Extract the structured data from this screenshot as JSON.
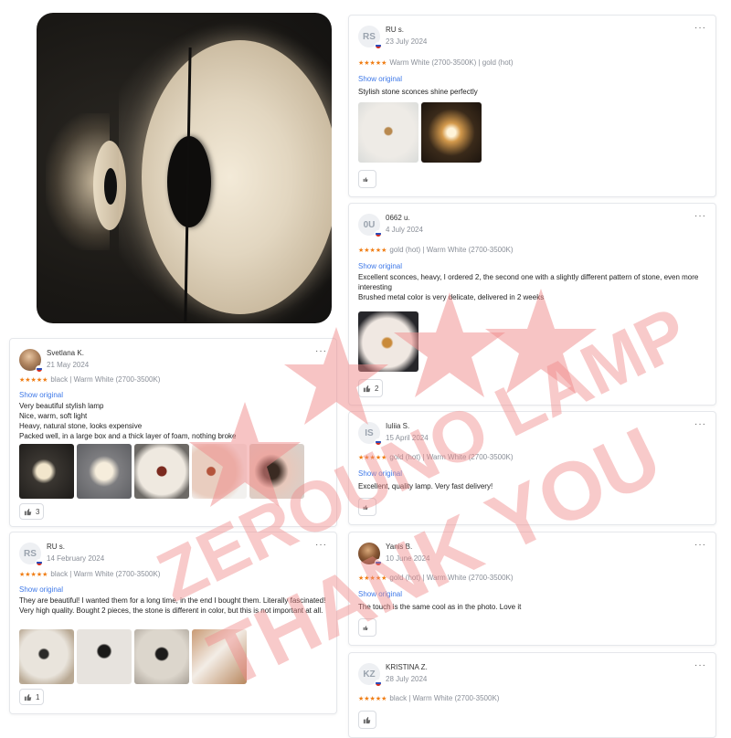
{
  "hero": {
    "alt": "wall sconce photo"
  },
  "reviews_left": [
    {
      "initials": "",
      "avatar_type": "photo",
      "name": "Svetlana K.",
      "date": "21 May 2024",
      "stars": "★★★★★",
      "variant": "black | Warm White (2700-3500K)",
      "show_original": "Show original",
      "lines": [
        "Very beautiful stylish lamp",
        "Nice, warm, soft light",
        "Heavy, natural stone, looks expensive",
        "Packed well, in a large box and a thick layer of foam, nothing broke"
      ],
      "likes": "3",
      "more": "···"
    },
    {
      "initials": "RS",
      "avatar_type": "initials",
      "name": "RU s.",
      "date": "14 February 2024",
      "stars": "★★★★★",
      "variant": "black | Warm White (2700-3500K)",
      "show_original": "Show original",
      "lines": [
        "They are beautiful! I wanted them for a long time, in the end I bought them. Literally fascinated!",
        "Very high quality. Bought 2 pieces, the stone is different in color, but this is not important at all."
      ],
      "likes": "1",
      "more": "···"
    }
  ],
  "reviews_right": [
    {
      "initials": "RS",
      "avatar_type": "initials",
      "name": "RU s.",
      "date": "23 July 2024",
      "stars": "★★★★★",
      "variant": "Warm White (2700-3500K) | gold (hot)",
      "show_original": "Show original",
      "lines": [
        "Stylish stone sconces shine perfectly"
      ],
      "likes": "",
      "more": "···"
    },
    {
      "initials": "0U",
      "avatar_type": "initials",
      "name": "0662 u.",
      "date": "4 July 2024",
      "stars": "★★★★★",
      "variant": "gold (hot) | Warm White (2700-3500K)",
      "show_original": "Show original",
      "lines": [
        "Excellent sconces, heavy, I ordered 2, the second one with a slightly different pattern of stone, even more interesting",
        "Brushed metal color is very delicate, delivered in 2 weeks"
      ],
      "likes": "2",
      "more": "···"
    },
    {
      "initials": "IS",
      "avatar_type": "initials",
      "name": "Iuliia S.",
      "date": "15 April 2024",
      "stars": "★★★★★",
      "variant": "gold (hot) | Warm White (2700-3500K)",
      "show_original": "Show original",
      "lines": [
        "Excellent, quality lamp. Very fast delivery!"
      ],
      "likes": "",
      "more": "···"
    },
    {
      "initials": "",
      "avatar_type": "photo2",
      "name": "Yanis B.",
      "date": "10 June 2024",
      "stars": "★★★★★",
      "variant": "gold (hot) | Warm White (2700-3500K)",
      "show_original": "Show original",
      "lines": [
        "The touch is the same cool as in the photo. Love it"
      ],
      "likes": "",
      "more": "···"
    },
    {
      "initials": "KZ",
      "avatar_type": "initials",
      "name": "KRISTINA Z.",
      "date": "28 July 2024",
      "stars": "★★★★★",
      "variant": "black | Warm White (2700-3500K)",
      "show_original": "",
      "lines": [],
      "likes": "",
      "more": "···"
    }
  ],
  "watermark": {
    "line1": "ZEROUNO LAMP",
    "line2": "THANK YOU",
    "color": "#f08a8a"
  },
  "colors": {
    "star": "#f07d14",
    "link": "#3f79e8",
    "border": "#e5e7eb"
  }
}
